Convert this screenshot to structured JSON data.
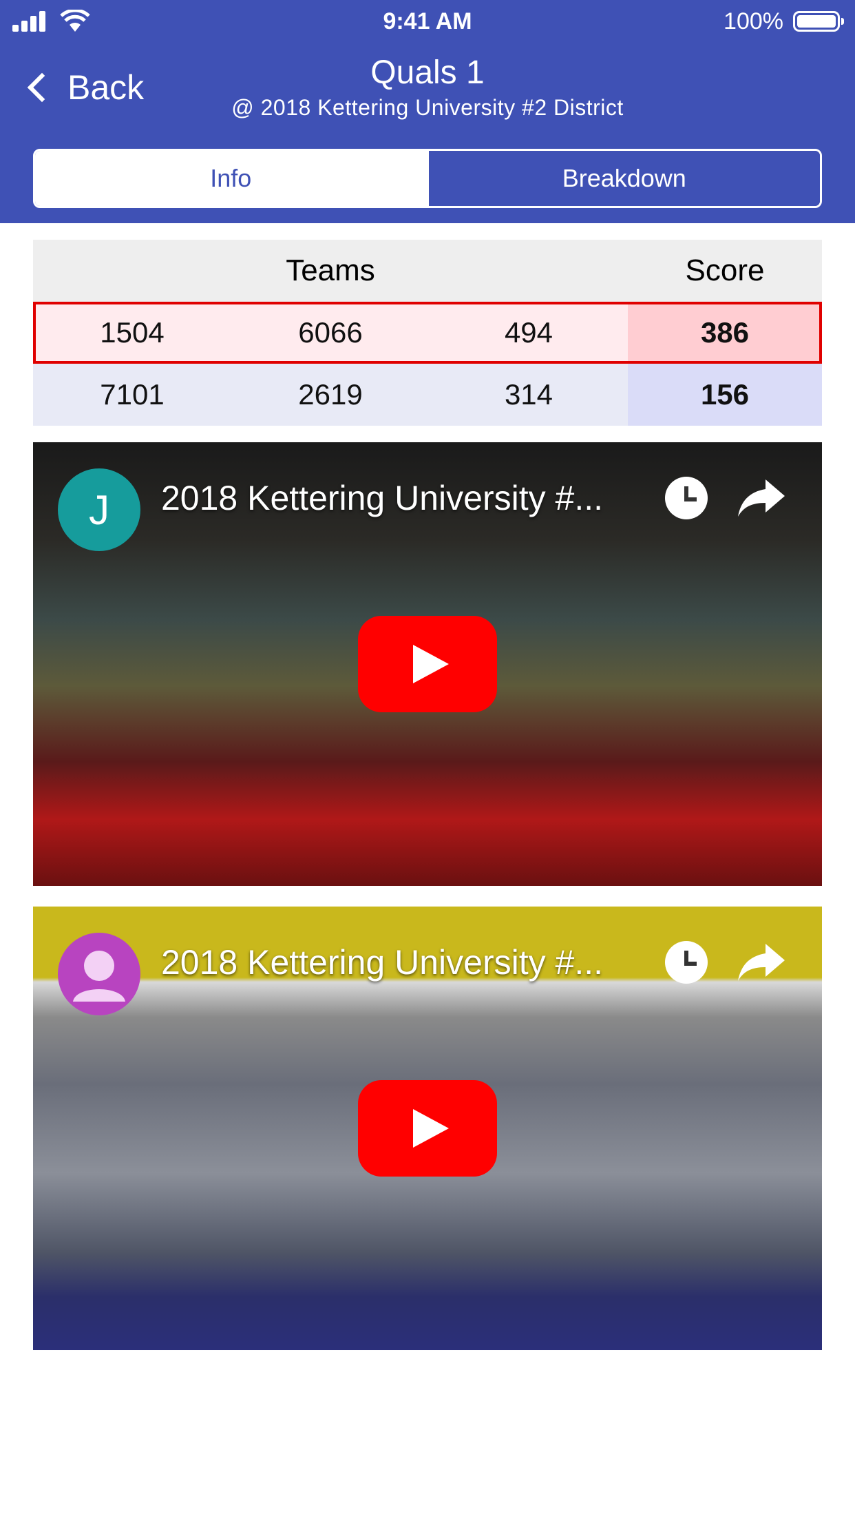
{
  "status_bar": {
    "time": "9:41 AM",
    "battery_percent": "100%"
  },
  "nav": {
    "back_label": "Back",
    "title": "Quals 1",
    "subtitle": "@ 2018 Kettering University #2 District"
  },
  "tabs": [
    {
      "label": "Info",
      "selected": true
    },
    {
      "label": "Breakdown",
      "selected": false
    }
  ],
  "score_table": {
    "headers": {
      "teams": "Teams",
      "score": "Score"
    },
    "red": {
      "teams": [
        "1504",
        "6066",
        "494"
      ],
      "score": "386"
    },
    "blue": {
      "teams": [
        "7101",
        "2619",
        "314"
      ],
      "score": "156"
    },
    "colors": {
      "red_highlight": "#e00000",
      "red_bg": "#ffebee",
      "blue_bg": "#e8eaf6"
    }
  },
  "videos": [
    {
      "title": "2018 Kettering University #...",
      "avatar_letter": "J",
      "avatar_color": "#169c9c",
      "icons": [
        "play-icon",
        "clock-icon",
        "share-icon"
      ]
    },
    {
      "title": "2018 Kettering University #...",
      "avatar_letter": "",
      "avatar_color": "#b844c0",
      "icons": [
        "play-icon",
        "clock-icon",
        "share-icon"
      ]
    }
  ],
  "theme": {
    "primary": "#3f51b5",
    "play_button": "#ff0000"
  }
}
